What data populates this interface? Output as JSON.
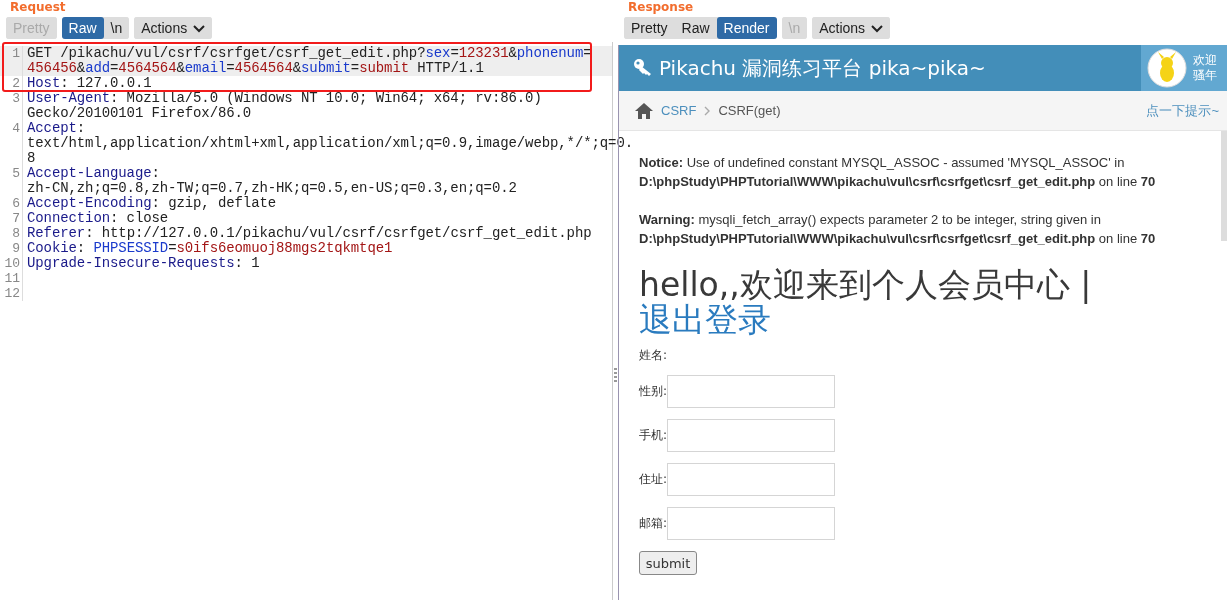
{
  "request": {
    "title": "Request",
    "tabs": [
      {
        "label": "Pretty",
        "kind": "toggle",
        "selected": false,
        "disabled": true
      },
      {
        "label": "Raw",
        "kind": "toggle",
        "selected": true,
        "disabled": false
      },
      {
        "label": "\\n",
        "kind": "toggle",
        "selected": false,
        "disabled": false
      },
      {
        "label": "Actions",
        "kind": "menu",
        "selected": false,
        "disabled": false
      }
    ],
    "lines": [
      {
        "number": "1",
        "current": true,
        "rows": [
          {
            "segments": [
              {
                "kind": "plain",
                "text": "GET /pikachu/vul/csrf/csrfget/csrf_get_edit.php?"
              },
              {
                "kind": "param",
                "text": "sex"
              },
              {
                "kind": "plain",
                "text": "="
              },
              {
                "kind": "value",
                "text": "123231"
              },
              {
                "kind": "plain",
                "text": "&"
              },
              {
                "kind": "param",
                "text": "phonenum"
              },
              {
                "kind": "plain",
                "text": "="
              }
            ]
          },
          {
            "segments": [
              {
                "kind": "value",
                "text": "456456"
              },
              {
                "kind": "plain",
                "text": "&"
              },
              {
                "kind": "param",
                "text": "add"
              },
              {
                "kind": "plain",
                "text": "="
              },
              {
                "kind": "value",
                "text": "4564564"
              },
              {
                "kind": "plain",
                "text": "&"
              },
              {
                "kind": "param",
                "text": "email"
              },
              {
                "kind": "plain",
                "text": "="
              },
              {
                "kind": "value",
                "text": "4564564"
              },
              {
                "kind": "plain",
                "text": "&"
              },
              {
                "kind": "param",
                "text": "submit"
              },
              {
                "kind": "plain",
                "text": "="
              },
              {
                "kind": "value",
                "text": "submit"
              },
              {
                "kind": "plain",
                "text": " HTTP/1.1"
              }
            ]
          }
        ]
      },
      {
        "number": "2",
        "current": false,
        "rows": [
          {
            "segments": [
              {
                "kind": "header",
                "text": "Host"
              },
              {
                "kind": "plain",
                "text": ": 127.0.0.1"
              }
            ]
          }
        ]
      },
      {
        "number": "3",
        "current": false,
        "rows": [
          {
            "segments": [
              {
                "kind": "header",
                "text": "User-Agent"
              },
              {
                "kind": "plain",
                "text": ": Mozilla/5.0 (Windows NT 10.0; Win64; x64; rv:86.0)"
              }
            ]
          },
          {
            "segments": [
              {
                "kind": "plain",
                "text": "Gecko/20100101 Firefox/86.0"
              }
            ]
          }
        ]
      },
      {
        "number": "4",
        "current": false,
        "rows": [
          {
            "segments": [
              {
                "kind": "header",
                "text": "Accept"
              },
              {
                "kind": "plain",
                "text": ":"
              }
            ]
          },
          {
            "segments": [
              {
                "kind": "plain",
                "text": "text/html,application/xhtml+xml,application/xml;q=0.9,image/webp,*/*;q=0."
              }
            ]
          },
          {
            "segments": [
              {
                "kind": "plain",
                "text": "8"
              }
            ]
          }
        ]
      },
      {
        "number": "5",
        "current": false,
        "rows": [
          {
            "segments": [
              {
                "kind": "header",
                "text": "Accept-Language"
              },
              {
                "kind": "plain",
                "text": ":"
              }
            ]
          },
          {
            "segments": [
              {
                "kind": "plain",
                "text": "zh-CN,zh;q=0.8,zh-TW;q=0.7,zh-HK;q=0.5,en-US;q=0.3,en;q=0.2"
              }
            ]
          }
        ]
      },
      {
        "number": "6",
        "current": false,
        "rows": [
          {
            "segments": [
              {
                "kind": "header",
                "text": "Accept-Encoding"
              },
              {
                "kind": "plain",
                "text": ": gzip, deflate"
              }
            ]
          }
        ]
      },
      {
        "number": "7",
        "current": false,
        "rows": [
          {
            "segments": [
              {
                "kind": "header",
                "text": "Connection"
              },
              {
                "kind": "plain",
                "text": ": close"
              }
            ]
          }
        ]
      },
      {
        "number": "8",
        "current": false,
        "rows": [
          {
            "segments": [
              {
                "kind": "header",
                "text": "Referer"
              },
              {
                "kind": "plain",
                "text": ": http://127.0.0.1/pikachu/vul/csrf/csrfget/csrf_get_edit.php"
              }
            ]
          }
        ]
      },
      {
        "number": "9",
        "current": false,
        "rows": [
          {
            "segments": [
              {
                "kind": "header",
                "text": "Cookie"
              },
              {
                "kind": "plain",
                "text": ": "
              },
              {
                "kind": "param",
                "text": "PHPSESSID"
              },
              {
                "kind": "plain",
                "text": "="
              },
              {
                "kind": "value",
                "text": "s0ifs6eomuoj88mgs2tqkmtqe1"
              }
            ]
          }
        ]
      },
      {
        "number": "10",
        "current": false,
        "rows": [
          {
            "segments": [
              {
                "kind": "header",
                "text": "Upgrade-Insecure-Requests"
              },
              {
                "kind": "plain",
                "text": ": 1"
              }
            ]
          }
        ]
      },
      {
        "number": "11",
        "current": false
      },
      {
        "number": "12",
        "current": false
      }
    ]
  },
  "response": {
    "title": "Response",
    "tabs": [
      {
        "label": "Pretty",
        "kind": "toggle",
        "selected": false,
        "disabled": false
      },
      {
        "label": "Raw",
        "kind": "toggle",
        "selected": false,
        "disabled": false
      },
      {
        "label": "Render",
        "kind": "toggle",
        "selected": true,
        "disabled": false
      },
      {
        "label": "\\n",
        "kind": "toggle",
        "selected": false,
        "disabled": true
      },
      {
        "label": "Actions",
        "kind": "menu",
        "selected": false,
        "disabled": false
      }
    ],
    "page": {
      "brand": "Pikachu 漏洞练习平台 pika~pika~",
      "greeting": "欢迎骚年",
      "breadcrumb": [
        {
          "label": "CSRF",
          "link": true
        },
        {
          "label": "CSRF(get)",
          "link": false
        }
      ],
      "hint": "点一下提示~",
      "messages": [
        "**Notice:** Use of undefined constant MYSQL_ASSOC - assumed 'MYSQL_ASSOC' in **D:\\phpStudy\\PHPTutorial\\WWW\\pikachu\\vul\\csrf\\csrfget\\csrf_get_edit.php** on line **70**",
        "**Warning:** mysqli_fetch_array() expects parameter 2 to be integer, string given in **D:\\phpStudy\\PHPTutorial\\WWW\\pikachu\\vul\\csrf\\csrfget\\csrf_get_edit.php** on line **70**"
      ],
      "heading": "hello,,欢迎来到个人会员中心 | ",
      "logout": "退出登录",
      "fields": [
        {
          "label": "姓名:",
          "kind": "text"
        },
        {
          "label": "性别:",
          "kind": "input"
        },
        {
          "label": "手机:",
          "kind": "input"
        },
        {
          "label": "住址:",
          "kind": "input"
        },
        {
          "label": "邮箱:",
          "kind": "input"
        }
      ],
      "submit": "submit"
    }
  }
}
